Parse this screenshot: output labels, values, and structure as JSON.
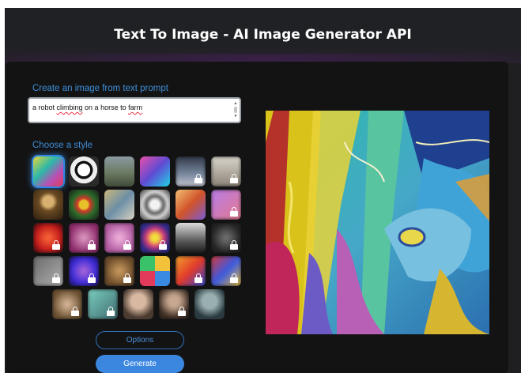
{
  "header": {
    "title": "Text To Image - AI Image Generator API"
  },
  "form": {
    "prompt_label": "Create an image from text prompt",
    "prompt_parts": [
      "a robot ",
      "climbing",
      " on a horse to ",
      "farm"
    ],
    "style_label": "Choose a style"
  },
  "styles": [
    {
      "icon": "abstract-colorful-style",
      "locked": false,
      "selected": true
    },
    {
      "icon": "panda-style",
      "locked": false
    },
    {
      "icon": "misty-landscape-style",
      "locked": false
    },
    {
      "icon": "cyberpunk-robot-style",
      "locked": false
    },
    {
      "icon": "portrait-woman-style",
      "locked": true
    },
    {
      "icon": "sketch-figures-style",
      "locked": true
    },
    {
      "icon": "renaissance-portrait-style",
      "locked": false
    },
    {
      "icon": "flower-bouquet-style",
      "locked": false
    },
    {
      "icon": "ballet-painting-style",
      "locked": false
    },
    {
      "icon": "metallic-sphere-style",
      "locked": false
    },
    {
      "icon": "3d-render-style",
      "locked": false
    },
    {
      "icon": "purple-abstract-style",
      "locked": true
    },
    {
      "icon": "red-portrait-style",
      "locked": true
    },
    {
      "icon": "pink-portrait-style",
      "locked": true
    },
    {
      "icon": "pink-blur-style",
      "locked": true
    },
    {
      "icon": "pop-art-portrait-style",
      "locked": true
    },
    {
      "icon": "modern-house-style",
      "locked": false
    },
    {
      "icon": "dark-sketch-style",
      "locked": true
    },
    {
      "icon": "gray-blur-style",
      "locked": true
    },
    {
      "icon": "purple-glow-style",
      "locked": true
    },
    {
      "icon": "golden-blur-style",
      "locked": true
    },
    {
      "icon": "emoji-grid-style",
      "locked": false
    },
    {
      "icon": "red-orange-abstract-style",
      "locked": true
    },
    {
      "icon": "mosaic-style",
      "locked": true
    },
    {
      "icon": "cat-style",
      "locked": true
    },
    {
      "icon": "teal-blur-style",
      "locked": true
    },
    {
      "icon": "woman-portrait-style",
      "locked": false
    },
    {
      "icon": "man-with-hat-style",
      "locked": true
    },
    {
      "icon": "zombie-portrait-style",
      "locked": false
    }
  ],
  "buttons": {
    "options": "Options",
    "generate": "Generate"
  },
  "colors": {
    "accent": "#3b87e0",
    "label": "#3e8ed6",
    "card": "#131314",
    "page": "#1f1f22"
  },
  "output": {
    "description_icon": "generated-image"
  }
}
